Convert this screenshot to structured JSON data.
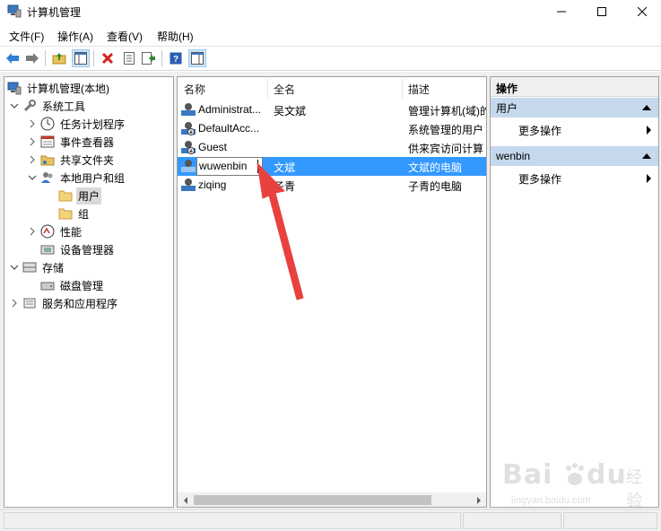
{
  "window": {
    "title": "计算机管理"
  },
  "menu": [
    {
      "label": "文件(F)"
    },
    {
      "label": "操作(A)"
    },
    {
      "label": "查看(V)"
    },
    {
      "label": "帮助(H)"
    }
  ],
  "tree": [
    {
      "label": "计算机管理(本地)",
      "icon": "computer-management-icon"
    },
    {
      "label": "系统工具",
      "icon": "tools-icon"
    },
    {
      "label": "任务计划程序",
      "icon": "clock-icon"
    },
    {
      "label": "事件查看器",
      "icon": "event-viewer-icon"
    },
    {
      "label": "共享文件夹",
      "icon": "shared-folder-icon"
    },
    {
      "label": "本地用户和组",
      "icon": "users-icon"
    },
    {
      "label": "用户",
      "icon": "folder-icon"
    },
    {
      "label": "组",
      "icon": "folder-icon"
    },
    {
      "label": "性能",
      "icon": "performance-icon"
    },
    {
      "label": "设备管理器",
      "icon": "device-manager-icon"
    },
    {
      "label": "存储",
      "icon": "storage-icon"
    },
    {
      "label": "磁盘管理",
      "icon": "disk-icon"
    },
    {
      "label": "服务和应用程序",
      "icon": "services-icon"
    }
  ],
  "list": {
    "columns": [
      "名称",
      "全名",
      "描述"
    ],
    "rows": [
      {
        "name": "Administrat...",
        "full_name": "吴文斌",
        "description": "管理计算机(域)的"
      },
      {
        "name": "DefaultAcc...",
        "full_name": "",
        "description": "系统管理的用户"
      },
      {
        "name": "Guest",
        "full_name": "",
        "description": "供来宾访问计算"
      },
      {
        "name": "wuwenbin",
        "full_name": "文斌",
        "description": "文斌的电脑"
      },
      {
        "name": "ziqing",
        "full_name": "子青",
        "description": "子青的电脑"
      }
    ]
  },
  "actions": {
    "header": "操作",
    "groups": [
      {
        "title": "用户",
        "item": "更多操作"
      },
      {
        "title": "wenbin",
        "item": "更多操作"
      }
    ]
  },
  "watermark": {
    "brand": "Bai",
    "cn": "经验",
    "url": "jingyan.baidu.com"
  },
  "colors": {
    "selection": "#3399ff",
    "action_group": "#c5d8ec",
    "arrow": "#e8413f"
  }
}
